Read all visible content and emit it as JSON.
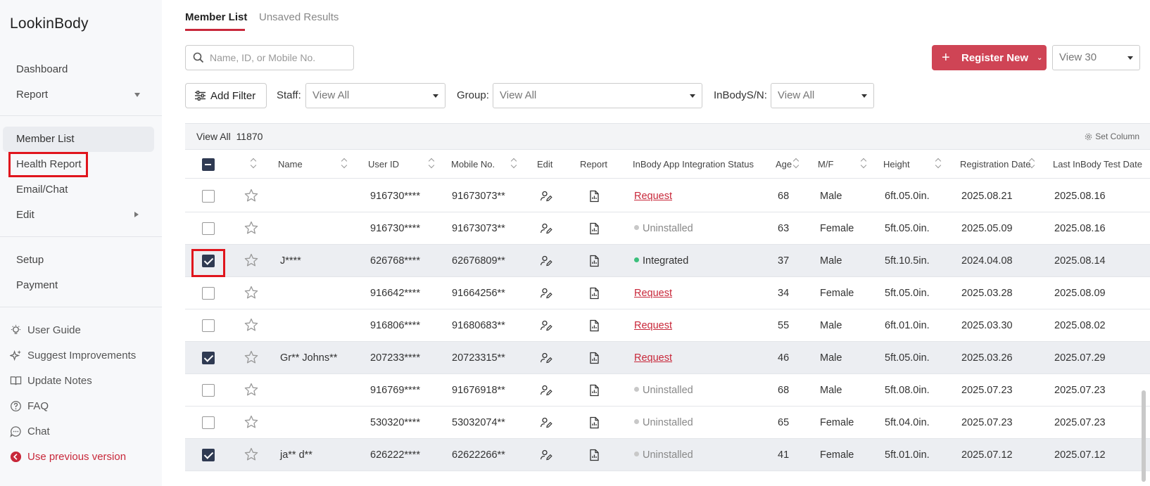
{
  "app": {
    "logo": "LookinBody"
  },
  "sidebar": {
    "items": [
      {
        "label": "Dashboard"
      },
      {
        "label": "Report"
      },
      {
        "label": "Member List"
      },
      {
        "label": "Health Report"
      },
      {
        "label": "Email/Chat"
      },
      {
        "label": "Edit"
      },
      {
        "label": "Setup"
      },
      {
        "label": "Payment"
      }
    ],
    "utilities": [
      {
        "label": "User Guide",
        "icon": "lightbulb-icon"
      },
      {
        "label": "Suggest Improvements",
        "icon": "sparkle-icon"
      },
      {
        "label": "Update Notes",
        "icon": "book-icon"
      },
      {
        "label": "FAQ",
        "icon": "question-icon"
      },
      {
        "label": "Chat",
        "icon": "chat-bubble-icon"
      },
      {
        "label": "Use previous version",
        "icon": "back-arrow-icon"
      }
    ]
  },
  "tabs": [
    {
      "label": "Member List",
      "active": true
    },
    {
      "label": "Unsaved Results",
      "active": false
    }
  ],
  "toolbar": {
    "search_placeholder": "Name, ID, or Mobile No.",
    "register_label": "Register New",
    "view_count": "View 30",
    "add_filter_label": "Add Filter",
    "staff_label": "Staff:",
    "staff_value": "View All",
    "group_label": "Group:",
    "group_value": "View All",
    "inbody_label": "InBodyS/N:",
    "inbody_value": "View All"
  },
  "table": {
    "view_all_label": "View All",
    "total_count": "11870",
    "set_column_label": "Set Column",
    "headers": {
      "name": "Name",
      "user_id": "User ID",
      "mobile": "Mobile No.",
      "edit": "Edit",
      "report": "Report",
      "integration": "InBody App Integration Status",
      "age": "Age",
      "sex": "M/F",
      "height": "Height",
      "reg_date": "Registration Date",
      "last_test": "Last InBody Test Date"
    },
    "rows": [
      {
        "checked": false,
        "name": "",
        "user_id": "916730****",
        "mobile": "91673073**",
        "status": "Request",
        "status_type": "request",
        "age": "68",
        "sex": "Male",
        "height": "6ft.05.0in.",
        "reg_date": "2025.08.21",
        "last_test": "2025.08.16"
      },
      {
        "checked": false,
        "name": "",
        "user_id": "916730****",
        "mobile": "91673073**",
        "status": "Uninstalled",
        "status_type": "uninstalled",
        "age": "63",
        "sex": "Female",
        "height": "5ft.05.0in.",
        "reg_date": "2025.05.09",
        "last_test": "2025.08.16"
      },
      {
        "checked": true,
        "name": "J****",
        "user_id": "626768****",
        "mobile": "62676809**",
        "status": "Integrated",
        "status_type": "integrated",
        "age": "37",
        "sex": "Male",
        "height": "5ft.10.5in.",
        "reg_date": "2024.04.08",
        "last_test": "2025.08.14"
      },
      {
        "checked": false,
        "name": "",
        "user_id": "916642****",
        "mobile": "91664256**",
        "status": "Request",
        "status_type": "request",
        "age": "34",
        "sex": "Female",
        "height": "5ft.05.0in.",
        "reg_date": "2025.03.28",
        "last_test": "2025.08.09"
      },
      {
        "checked": false,
        "name": "",
        "user_id": "916806****",
        "mobile": "91680683**",
        "status": "Request",
        "status_type": "request",
        "age": "55",
        "sex": "Male",
        "height": "6ft.01.0in.",
        "reg_date": "2025.03.30",
        "last_test": "2025.08.02"
      },
      {
        "checked": true,
        "name": "Gr** Johns**",
        "user_id": "207233****",
        "mobile": "20723315**",
        "status": "Request",
        "status_type": "request",
        "age": "46",
        "sex": "Male",
        "height": "5ft.05.0in.",
        "reg_date": "2025.03.26",
        "last_test": "2025.07.29"
      },
      {
        "checked": false,
        "name": "",
        "user_id": "916769****",
        "mobile": "91676918**",
        "status": "Uninstalled",
        "status_type": "uninstalled",
        "age": "68",
        "sex": "Male",
        "height": "5ft.08.0in.",
        "reg_date": "2025.07.23",
        "last_test": "2025.07.23"
      },
      {
        "checked": false,
        "name": "",
        "user_id": "530320****",
        "mobile": "53032074**",
        "status": "Uninstalled",
        "status_type": "uninstalled",
        "age": "65",
        "sex": "Female",
        "height": "5ft.04.0in.",
        "reg_date": "2025.07.23",
        "last_test": "2025.07.23"
      },
      {
        "checked": true,
        "name": "ja** d**",
        "user_id": "626222****",
        "mobile": "62622266**",
        "status": "Uninstalled",
        "status_type": "uninstalled",
        "age": "41",
        "sex": "Female",
        "height": "5ft.01.0in.",
        "reg_date": "2025.07.12",
        "last_test": "2025.07.12"
      }
    ]
  },
  "colors": {
    "accent": "#cf4455",
    "highlight_box": "#e0151d",
    "integrated": "#3bbf7c"
  }
}
